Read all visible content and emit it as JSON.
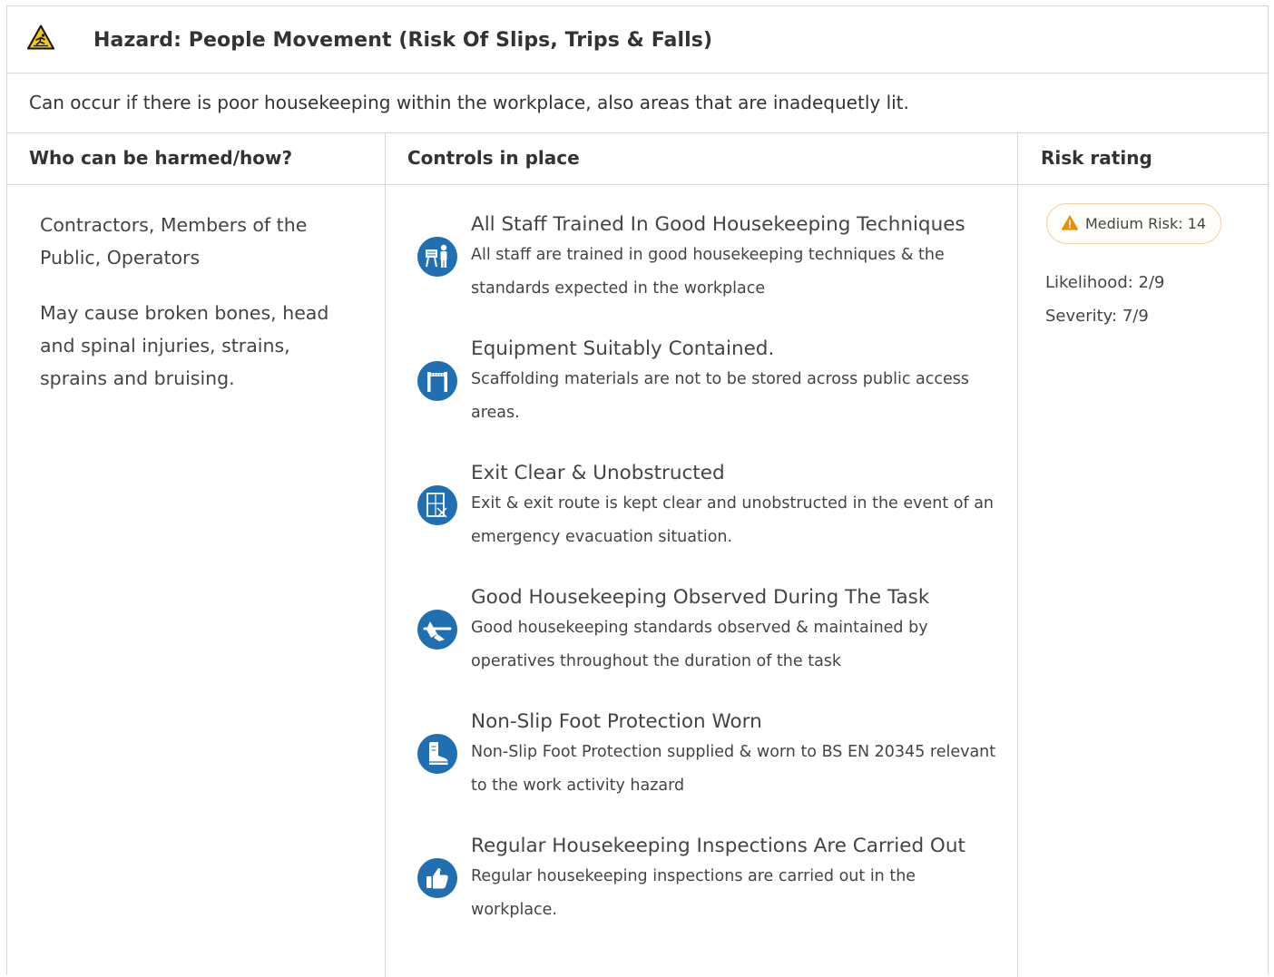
{
  "hazard": {
    "title": "Hazard:  People Movement (Risk Of Slips, Trips & Falls)",
    "description": "Can occur if there is poor housekeeping within the workplace, also areas that are inadequetly lit.",
    "icon": "slip-hazard-warning-icon"
  },
  "table": {
    "headers": {
      "who": "Who can be harmed/how?",
      "controls": "Controls in place",
      "risk": "Risk rating"
    }
  },
  "who": {
    "people": "Contractors, Members of the Public, Operators",
    "harm": "May cause broken bones, head and spinal injuries, strains, sprains and bruising."
  },
  "controls": [
    {
      "title": "All Staff Trained In Good Housekeeping Techniques",
      "description": "All staff are trained in good housekeeping techniques & the standards expected in the workplace",
      "icon": "training-icon"
    },
    {
      "title": "Equipment Suitably Contained.",
      "description": "Scaffolding materials are not to be stored across public access areas.",
      "icon": "barrier-icon"
    },
    {
      "title": "Exit Clear & Unobstructed",
      "description": "Exit & exit route is kept clear and unobstructed in the event of an emergency evacuation situation.",
      "icon": "exit-door-icon"
    },
    {
      "title": "Good Housekeeping Observed During The Task",
      "description": "Good housekeeping standards observed & maintained by operatives throughout the duration of the task",
      "icon": "broom-icon"
    },
    {
      "title": "Non-Slip Foot Protection Worn",
      "description": "Non-Slip Foot Protection supplied & worn to BS EN 20345 relevant to the work activity hazard",
      "icon": "safety-boot-icon"
    },
    {
      "title": "Regular Housekeeping Inspections Are Carried Out",
      "description": "Regular housekeeping inspections are carried out in the workplace.",
      "icon": "thumbs-up-icon"
    }
  ],
  "risk": {
    "badge": "Medium Risk: 14",
    "likelihood": "Likelihood: 2/9",
    "severity": "Severity: 7/9",
    "colors": {
      "accent": "#f08c00",
      "badge_border": "#f5cfa1",
      "icon_blue": "#1f6fb2"
    }
  }
}
